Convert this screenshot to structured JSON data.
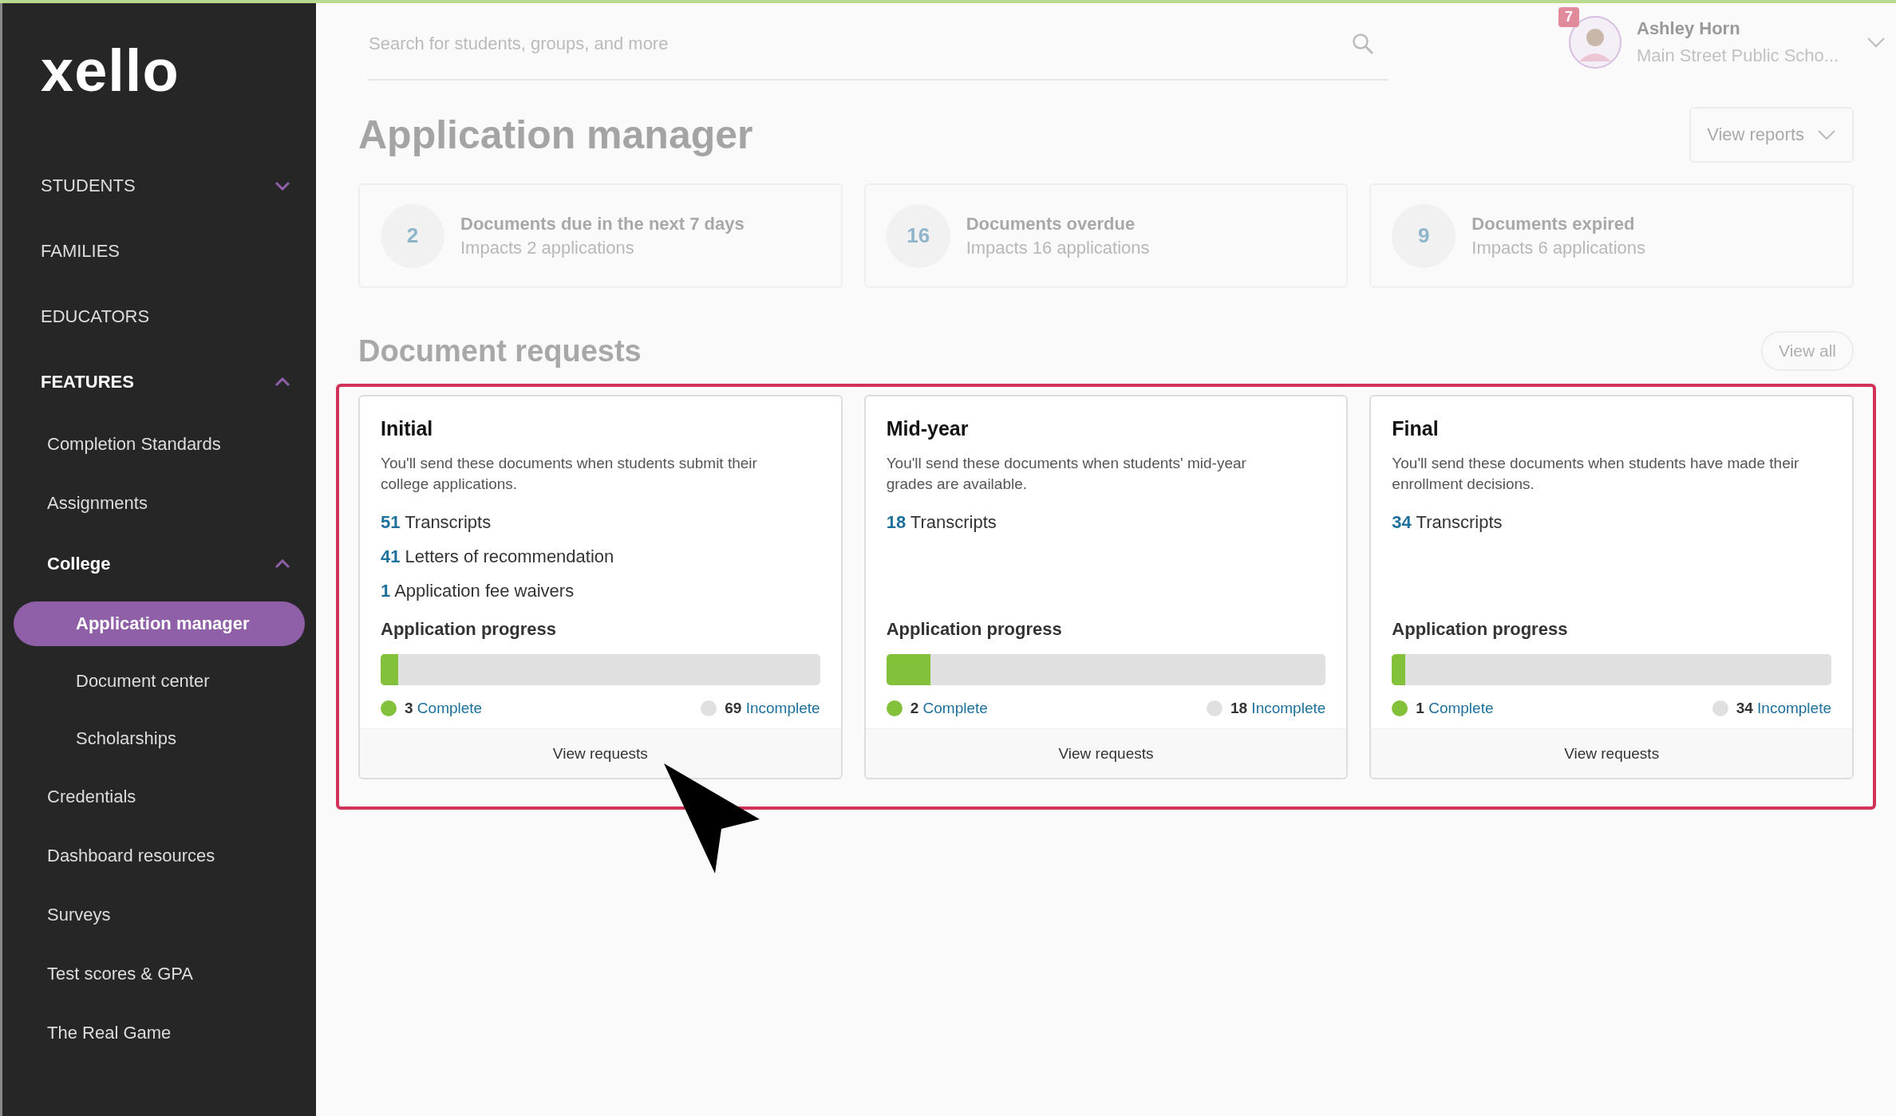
{
  "sidebar": {
    "logo": "xello",
    "items": [
      {
        "label": "STUDENTS",
        "expanded": false
      },
      {
        "label": "FAMILIES"
      },
      {
        "label": "EDUCATORS"
      },
      {
        "label": "FEATURES",
        "expanded": true,
        "children": [
          {
            "label": "Completion Standards",
            "kind": "link"
          },
          {
            "label": "Assignments",
            "kind": "link"
          },
          {
            "label": "College",
            "kind": "group",
            "expanded": true,
            "children": [
              {
                "label": "Application manager",
                "selected": true
              },
              {
                "label": "Document center",
                "selected": false
              },
              {
                "label": "Scholarships",
                "selected": false
              }
            ]
          },
          {
            "label": "Credentials",
            "kind": "link"
          },
          {
            "label": "Dashboard resources",
            "kind": "link"
          },
          {
            "label": "Surveys",
            "kind": "link"
          },
          {
            "label": "Test scores & GPA",
            "kind": "link"
          },
          {
            "label": "The Real Game",
            "kind": "link"
          }
        ]
      }
    ]
  },
  "search": {
    "placeholder": "Search for students, groups, and more"
  },
  "user": {
    "name": "Ashley Horn",
    "school": "Main Street Public Scho...",
    "notifications": "7"
  },
  "title": "Application manager",
  "reports_button": "View reports",
  "stats": [
    {
      "count": "2",
      "title": "Documents due in the next 7 days",
      "subtitle": "Impacts 2 applications"
    },
    {
      "count": "16",
      "title": "Documents overdue",
      "subtitle": "Impacts 16 applications"
    },
    {
      "count": "9",
      "title": "Documents expired",
      "subtitle": "Impacts 6 applications"
    }
  ],
  "requests": {
    "heading": "Document requests",
    "view_all": "View all",
    "cards": [
      {
        "title": "Initial",
        "description": "You'll send these documents when students submit their college applications.",
        "documents": [
          {
            "count": "51",
            "label": "Transcripts"
          },
          {
            "count": "41",
            "label": "Letters of recommendation"
          },
          {
            "count": "1",
            "label": "Application fee waivers"
          }
        ],
        "progress_label": "Application progress",
        "level": 0.04,
        "complete": {
          "count": "3",
          "label": "Complete"
        },
        "incomplete": {
          "count": "69",
          "label": "Incomplete"
        },
        "action": "View requests"
      },
      {
        "title": "Mid-year",
        "description": "You'll send these documents when students' mid-year grades are available.",
        "documents": [
          {
            "count": "18",
            "label": "Transcripts"
          }
        ],
        "progress_label": "Application progress",
        "level": 0.1,
        "complete": {
          "count": "2",
          "label": "Complete"
        },
        "incomplete": {
          "count": "18",
          "label": "Incomplete"
        },
        "action": "View requests"
      },
      {
        "title": "Final",
        "description": "You'll send these documents when students have made their enrollment decisions.",
        "documents": [
          {
            "count": "34",
            "label": "Transcripts"
          }
        ],
        "progress_label": "Application progress",
        "level": 0.03,
        "complete": {
          "count": "1",
          "label": "Complete"
        },
        "incomplete": {
          "count": "34",
          "label": "Incomplete"
        },
        "action": "View requests"
      }
    ]
  }
}
